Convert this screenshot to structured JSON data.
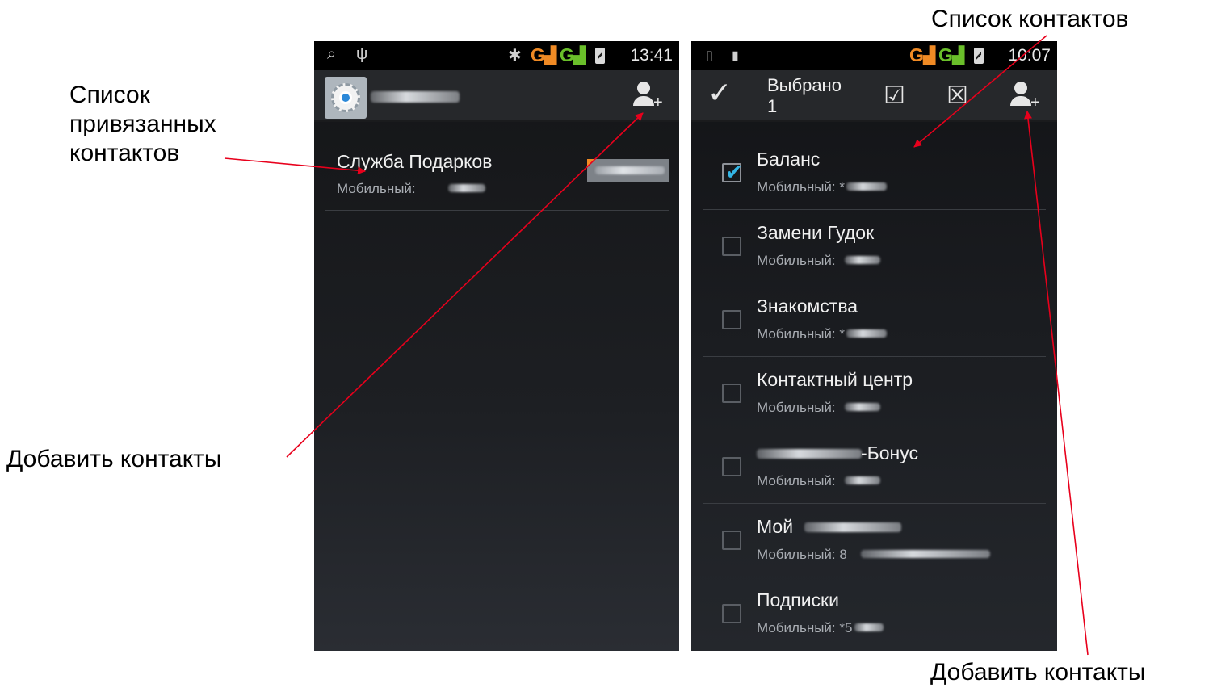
{
  "annotations": {
    "linked_contacts": "Список привязанных контактов",
    "add_contacts_left": "Добавить контакты",
    "contacts_list": "Список контактов",
    "add_contacts_right": "Добавить контакты"
  },
  "colors": {
    "arrow": "#e8001c",
    "checkmark": "#33b5e5",
    "signal_g_orange": "#f08a24",
    "signal_g_green": "#6abf2a"
  },
  "left_screen": {
    "status": {
      "time": "13:41",
      "icons": [
        "search-icon",
        "usb-icon",
        "bluetooth-icon",
        "signal-g-icon",
        "signal-g-icon",
        "battery-icon"
      ],
      "g": "G"
    },
    "actionbar": {
      "icon": "settings-gear-icon",
      "action": "person-add-icon"
    },
    "contact": {
      "name": "Служба Подарков",
      "phone_label": "Мобильный:"
    }
  },
  "right_screen": {
    "status": {
      "time": "10:07",
      "icons": [
        "sim-icon",
        "sd-card-icon",
        "signal-g-icon",
        "signal-g-icon",
        "battery-icon"
      ],
      "g": "G"
    },
    "actionbar": {
      "title_line1": "Выбрано",
      "title_line2": "1",
      "done_icon": "✓",
      "select_all_icon": "☑",
      "deselect_all_icon": "☒"
    },
    "contacts": [
      {
        "name": "Баланс",
        "phone": "Мобильный: *",
        "checked": true
      },
      {
        "name": "Замени Гудок",
        "phone": "Мобильный:",
        "checked": false
      },
      {
        "name": "Знакомства",
        "phone": "Мобильный: *",
        "checked": false
      },
      {
        "name": "Контактный центр",
        "phone": "Мобильный:",
        "checked": false
      },
      {
        "name": "-Бонус",
        "phone": "Мобильный:",
        "checked": false
      },
      {
        "name": "Мой",
        "phone": "Мобильный: 8",
        "checked": false
      },
      {
        "name": "Подписки",
        "phone": "Мобильный: *5",
        "checked": false
      }
    ]
  }
}
